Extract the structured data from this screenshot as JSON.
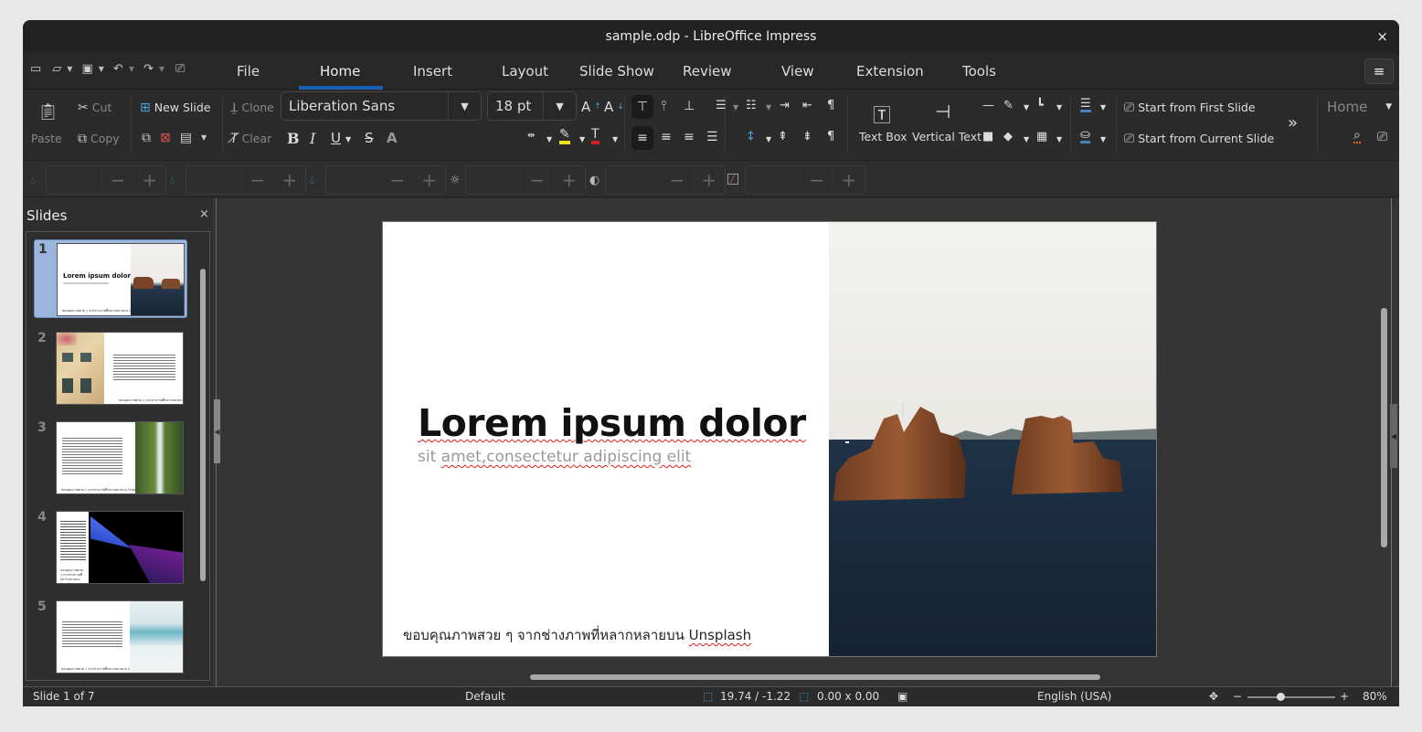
{
  "window": {
    "title": "sample.odp - LibreOffice Impress",
    "close_icon": "×"
  },
  "quick_access": {
    "new_icon": "⎘",
    "open_icon": "🗀",
    "save_icon": "💾",
    "undo_icon": "↶",
    "redo_icon": "↷",
    "present_icon": "▣"
  },
  "tabs": [
    {
      "label": "File"
    },
    {
      "label": "Home"
    },
    {
      "label": "Insert"
    },
    {
      "label": "Layout"
    },
    {
      "label": "Slide Show"
    },
    {
      "label": "Review"
    },
    {
      "label": "View"
    },
    {
      "label": "Extension"
    },
    {
      "label": "Tools"
    }
  ],
  "active_tab": "Home",
  "menu_icon": "≡",
  "ribbon": {
    "paste": "Paste",
    "cut": "Cut",
    "copy": "Copy",
    "new_slide": "New Slide",
    "clone": "Clone",
    "clear": "Clear",
    "font_name": "Liberation Sans",
    "font_size": "18 pt",
    "bold": "B",
    "italic": "I",
    "underline": "U",
    "strike": "S",
    "shadow": "A",
    "text_box": "Text Box",
    "vertical_text": "Vertical Text",
    "start_first": "Start from First Slide",
    "start_current": "Start from Current Slide",
    "more": "»",
    "context_dropdown": "Home"
  },
  "image_filter_bar": {
    "minus": "−",
    "plus": "+",
    "fields": [
      {
        "name": "red",
        "color": "#b23a48",
        "value": ""
      },
      {
        "name": "green",
        "color": "#2e8b57",
        "value": ""
      },
      {
        "name": "blue",
        "color": "#3a8fc7",
        "value": ""
      },
      {
        "name": "brightness",
        "color": "#bbbbbb",
        "value": ""
      },
      {
        "name": "contrast",
        "color": "#bbbbbb",
        "value": ""
      },
      {
        "name": "gamma",
        "color": "#d06060",
        "value": ""
      }
    ]
  },
  "slides_pane": {
    "title": "Slides",
    "close": "×",
    "slides": [
      {
        "number": "1",
        "title": "Lorem ipsum dolor",
        "credit": "ขอบคุณภาพสวย ๆ จากช่างภาพที่หลากหลายบน Unsplash"
      },
      {
        "number": "2",
        "credit": "ขอบคุณภาพสวย ๆ จากช่างภาพที่หลากหลายบน Unsplash"
      },
      {
        "number": "3",
        "credit": "ขอบคุณภาพสวย ๆ จากช่างภาพที่หลากหลายบน Unsplash"
      },
      {
        "number": "4",
        "credit": "ขอบคุณภาพสวย ๆ จากช่างภาพที่หลากหลายบน Unsplash"
      },
      {
        "number": "5",
        "credit": "ขอบคุณภาพสวย ๆ จากช่างภาพที่หลากหลายบน Unsplash"
      }
    ]
  },
  "slide": {
    "title": "Lorem ipsum dolor",
    "subtitle_plain": "sit ",
    "subtitle_wavy": "amet,consectetur adipiscing elit",
    "credit_plain": "ขอบคุณภาพสวย ๆ จากช่างภาพที่หลากหลายบน ",
    "credit_wavy": "Unsplash"
  },
  "status": {
    "slide_count": "Slide 1 of 7",
    "master": "Default",
    "position": "19.74 / -1.22",
    "size": "0.00 x 0.00",
    "language": "English (USA)",
    "zoom_minus": "−",
    "zoom_plus": "+",
    "zoom_level": "80%"
  }
}
